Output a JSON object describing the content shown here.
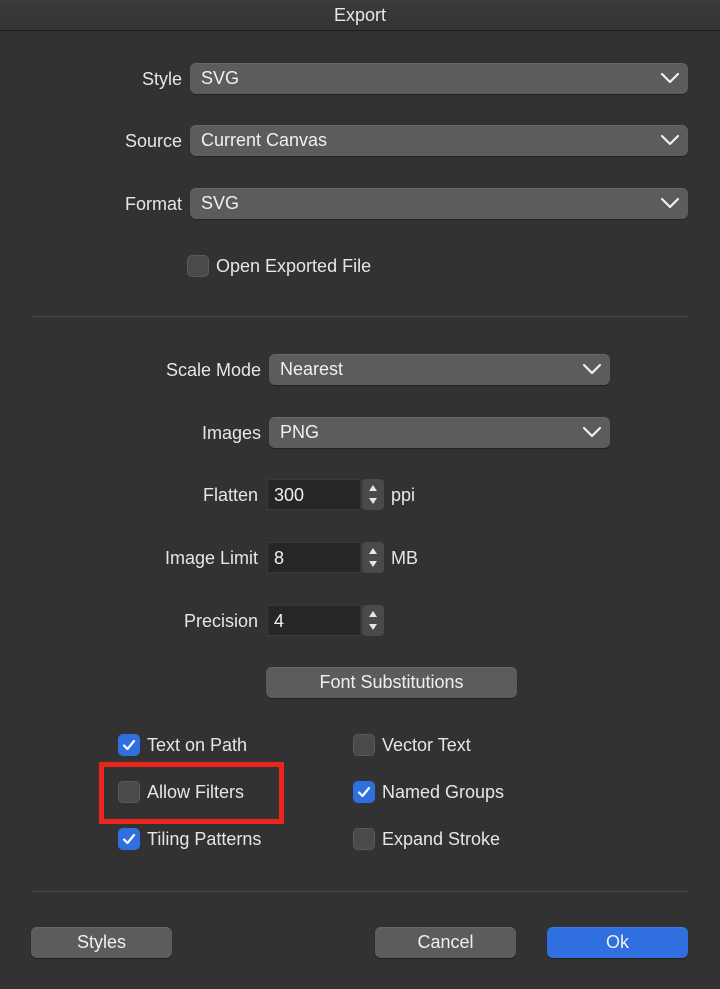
{
  "window": {
    "title": "Export"
  },
  "style": {
    "label": "Style",
    "value": "SVG"
  },
  "source": {
    "label": "Source",
    "value": "Current Canvas"
  },
  "format": {
    "label": "Format",
    "value": "SVG"
  },
  "open_exported": {
    "label": "Open Exported File",
    "checked": false
  },
  "scale_mode": {
    "label": "Scale Mode",
    "value": "Nearest"
  },
  "images": {
    "label": "Images",
    "value": "PNG"
  },
  "flatten": {
    "label": "Flatten",
    "value": "300",
    "unit": "ppi"
  },
  "image_limit": {
    "label": "Image Limit",
    "value": "8",
    "unit": "MB"
  },
  "precision": {
    "label": "Precision",
    "value": "4"
  },
  "font_substitutions": {
    "label": "Font Substitutions"
  },
  "options": {
    "text_on_path": {
      "label": "Text on Path",
      "checked": true
    },
    "vector_text": {
      "label": "Vector Text",
      "checked": false
    },
    "allow_filters": {
      "label": "Allow Filters",
      "checked": false
    },
    "named_groups": {
      "label": "Named Groups",
      "checked": true
    },
    "tiling_patterns": {
      "label": "Tiling Patterns",
      "checked": true
    },
    "expand_stroke": {
      "label": "Expand Stroke",
      "checked": false
    }
  },
  "footer": {
    "styles_label": "Styles",
    "cancel_label": "Cancel",
    "ok_label": "Ok"
  },
  "colors": {
    "accent": "#2f6fe0",
    "highlight": "#e8261a",
    "background": "#323232"
  }
}
